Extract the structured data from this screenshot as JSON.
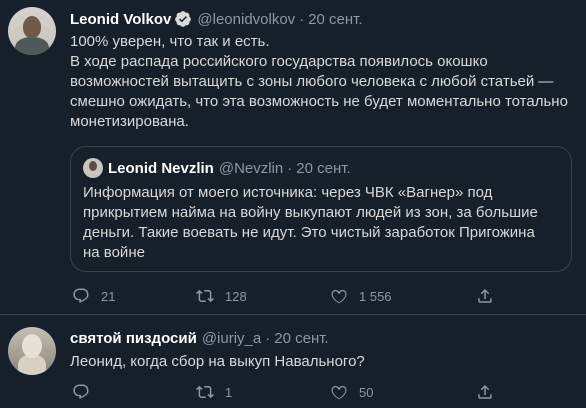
{
  "tweet1": {
    "author": {
      "name": "Leonid Volkov",
      "handle": "@leonidvolkov",
      "date": "20 сент."
    },
    "text_line1": "100% уверен, что так и есть.",
    "text_body": "В ходе распада российского государства появилось окошко возможностей вытащить с зоны любого человека с любой статьей — смешно ожидать, что эта возможность не будет моментально тотально монетизирована.",
    "quote": {
      "author": {
        "name": "Leonid Nevzlin",
        "handle": "@Nevzlin",
        "date": "20 сент."
      },
      "text": "Информация от моего источника: через ЧВК «Вагнер» под прикрытием найма на войну выкупают людей из зон, за большие деньги. Такие воевать не идут. Это чистый заработок Пригожина на войне"
    },
    "actions": {
      "replies": "21",
      "retweets": "128",
      "likes": "1 556"
    }
  },
  "tweet2": {
    "author": {
      "name": "святой пиздосий",
      "handle": "@iuriy_a",
      "date": "20 сент."
    },
    "text": "Леонид, когда сбор на выкуп Навального?",
    "actions": {
      "replies": "",
      "retweets": "1",
      "likes": "50"
    }
  },
  "separator": "·",
  "icons": [
    "verified-badge-icon",
    "reply-icon",
    "retweet-icon",
    "like-icon",
    "share-icon"
  ],
  "colors": {
    "background": "#15202b",
    "text": "#d9d9d9",
    "muted": "#8b98a5",
    "border": "#38444d",
    "verified": "#d9d9d9"
  }
}
